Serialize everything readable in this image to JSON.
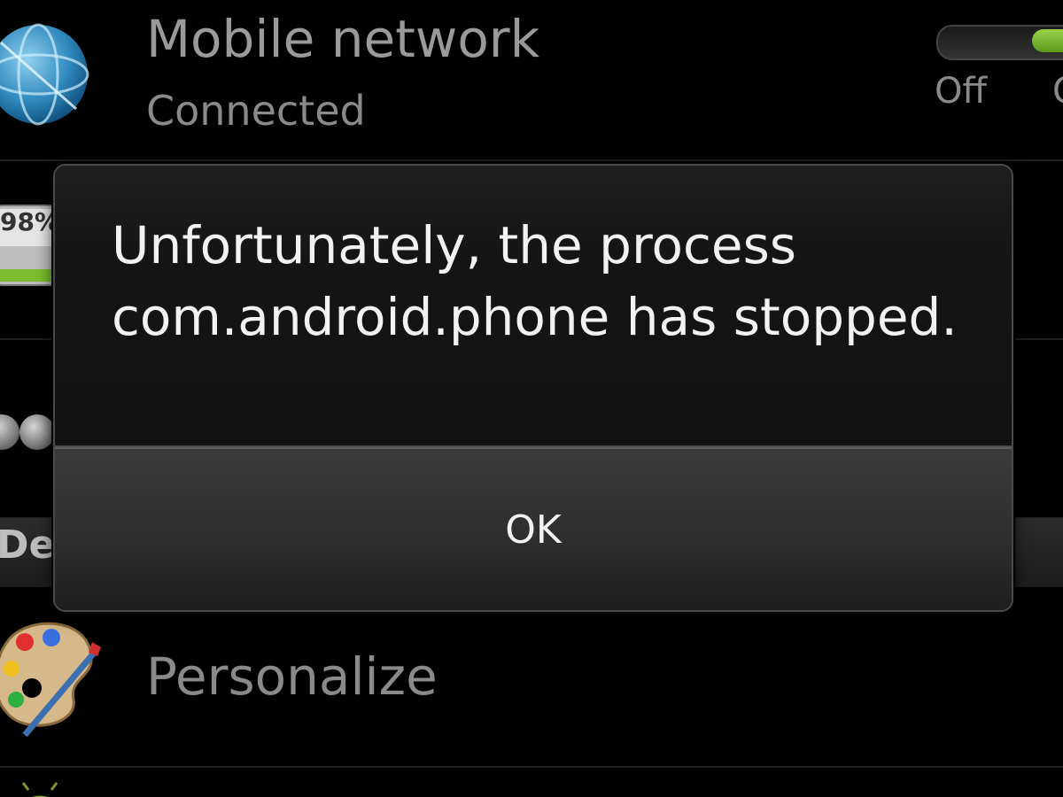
{
  "settings": {
    "mobile_network": {
      "title": "Mobile network",
      "status": "Connected",
      "icon": "globe-icon",
      "toggle": {
        "off_label": "Off",
        "on_label": "On",
        "state": "on",
        "accent_color": "#7bbd2e"
      }
    },
    "battery": {
      "percent_label": "98%",
      "icon": "battery-icon"
    },
    "device_section": {
      "header": "Devi"
    },
    "personalize": {
      "title": "Personalize",
      "icon": "palette-icon"
    }
  },
  "dialog": {
    "message": "Unfortunately, the process com.android.phone has stopped.",
    "ok_label": "OK"
  }
}
